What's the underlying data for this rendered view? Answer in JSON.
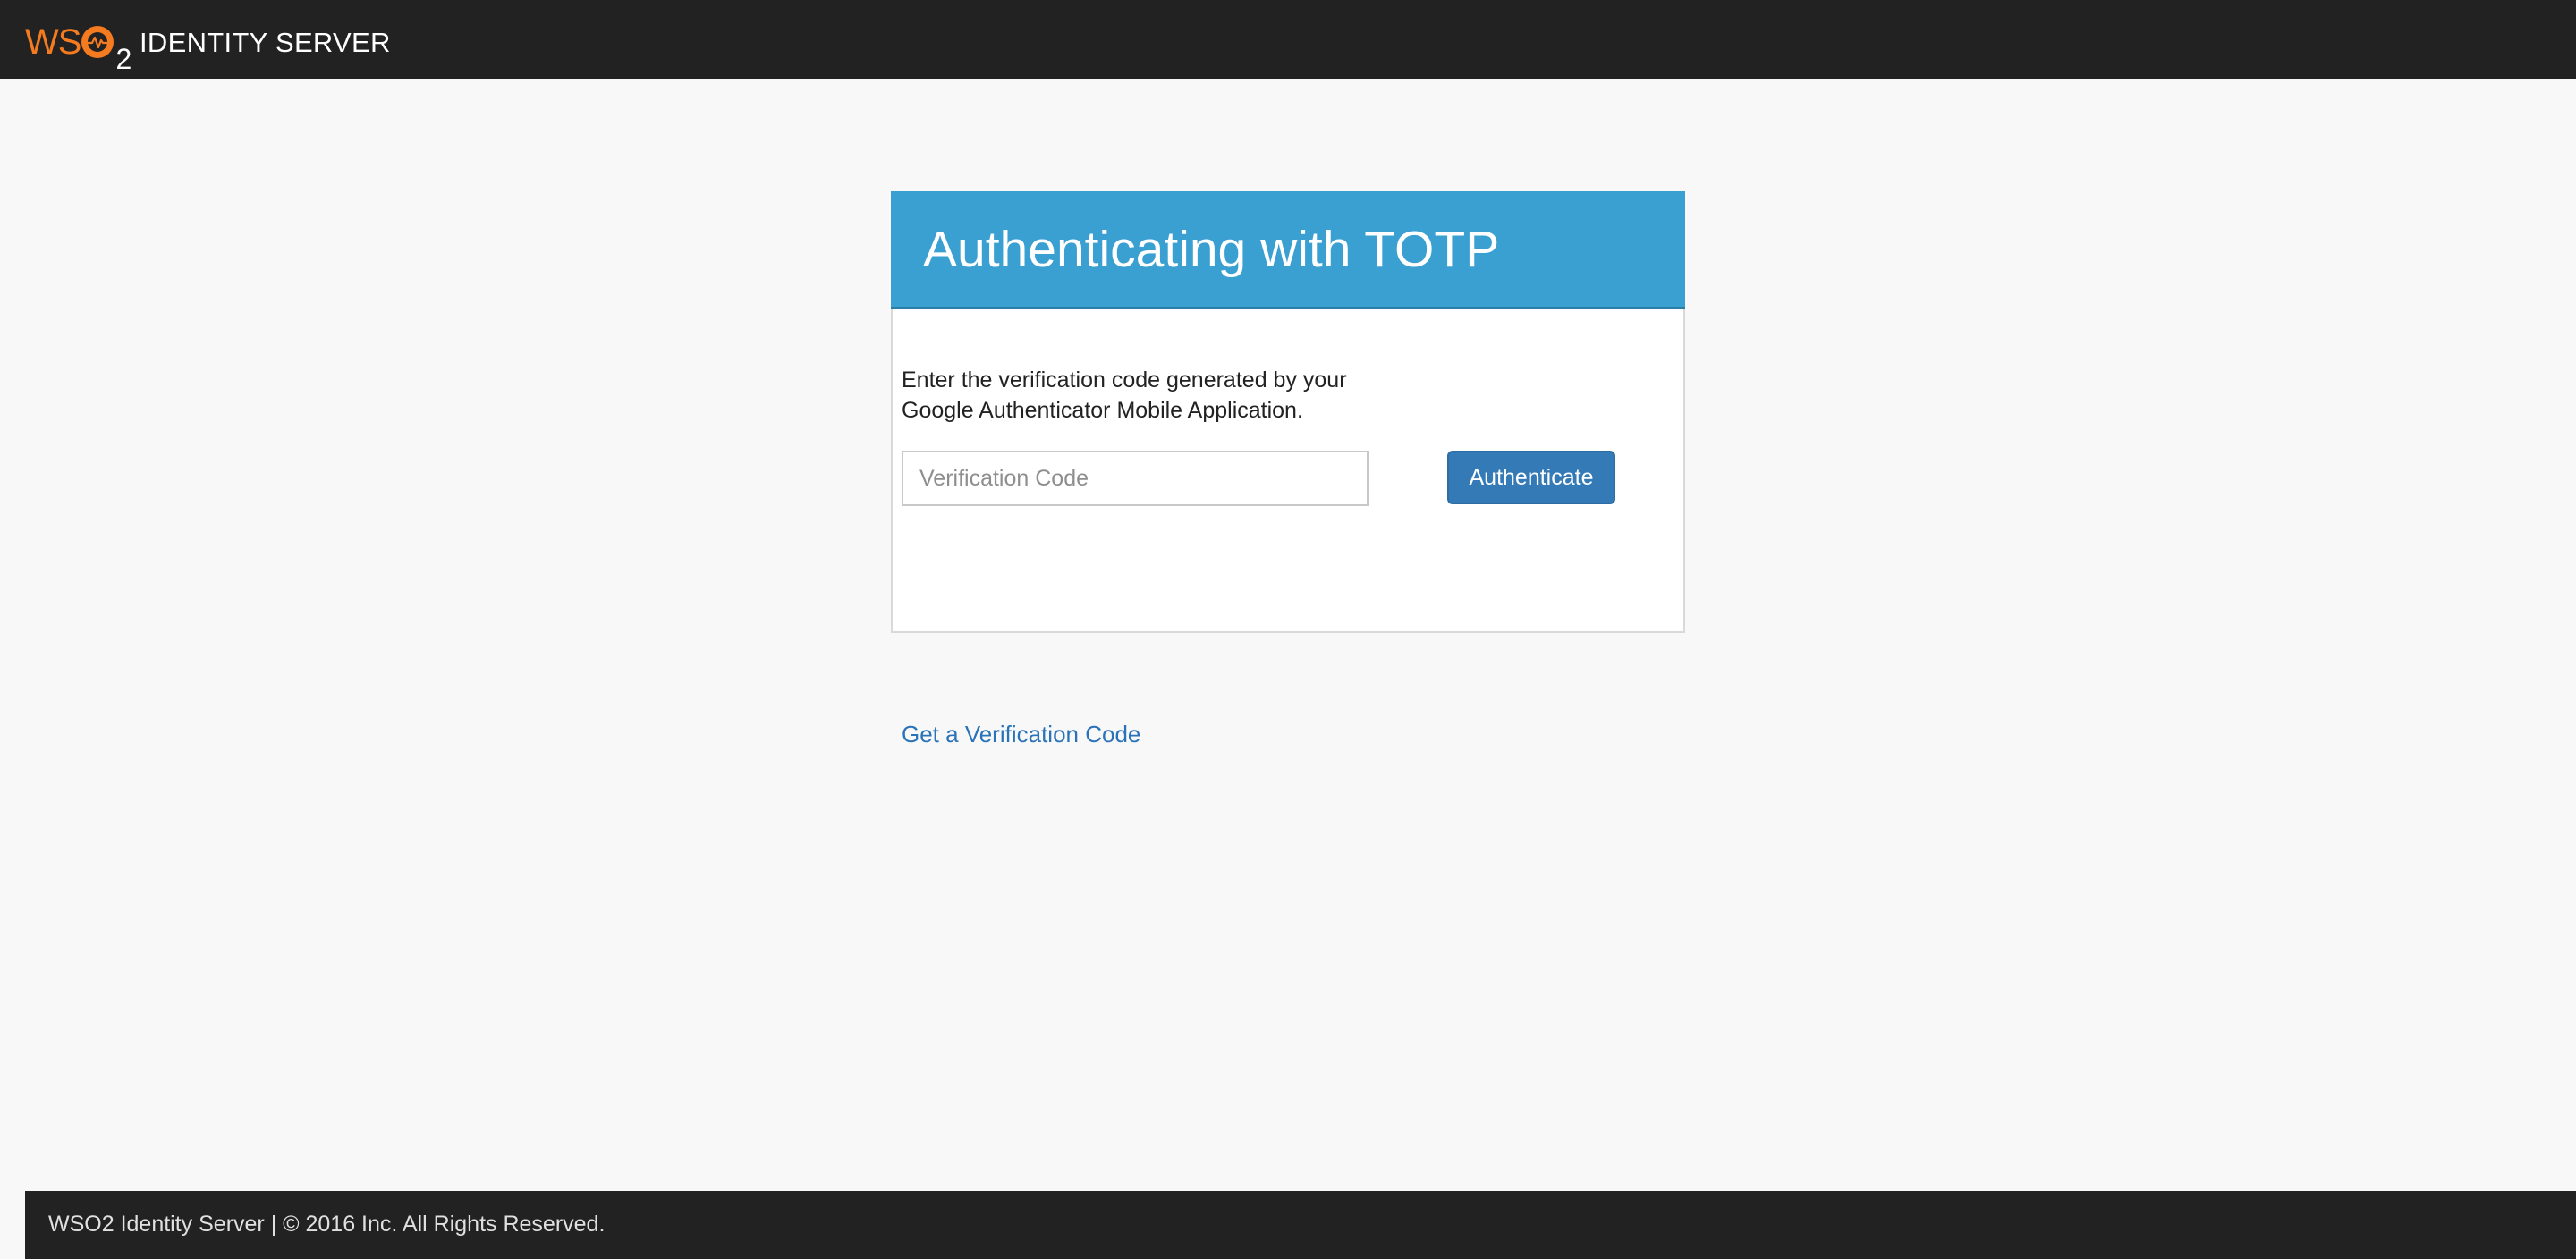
{
  "header": {
    "logo_text": "WSO2",
    "product_name": "IDENTITY SERVER",
    "brand_color": "#f47b20"
  },
  "card": {
    "title": "Authenticating with TOTP",
    "header_color": "#3a9fd1",
    "instructions": "Enter the verification code generated by your Google Authenticator Mobile Application.",
    "input": {
      "value": "",
      "placeholder": "Verification Code"
    },
    "authenticate_label": "Authenticate",
    "get_code_link": "Get a Verification Code"
  },
  "footer": {
    "text": "WSO2 Identity Server | © 2016 Inc. All Rights Reserved."
  }
}
